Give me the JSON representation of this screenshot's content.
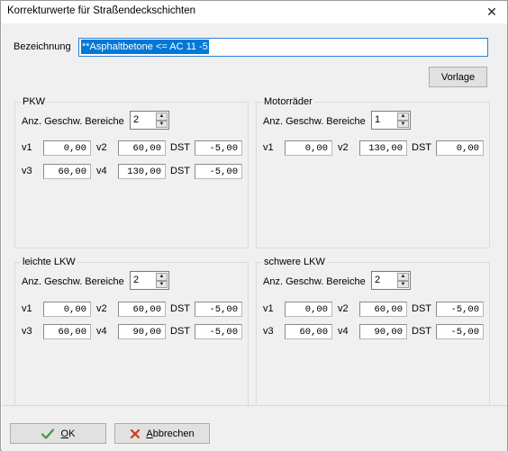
{
  "window": {
    "title": "Korrekturwerte für Straßendeckschichten",
    "close_glyph": "✕"
  },
  "name": {
    "label": "Bezeichnung",
    "value": "**Asphaltbetone <= AC 11 -5"
  },
  "template_button": "Vorlage",
  "common": {
    "ranges_label": "Anz. Geschw. Bereiche",
    "v1": "v1",
    "v2": "v2",
    "v3": "v3",
    "v4": "v4",
    "dst": "DST"
  },
  "groups": {
    "pkw": {
      "title": "PKW",
      "ranges": "2",
      "v1": "0,00",
      "v2": "60,00",
      "dst1": "-5,00",
      "v3": "60,00",
      "v4": "130,00",
      "dst2": "-5,00"
    },
    "motorraeder": {
      "title": "Motorräder",
      "ranges": "1",
      "v1": "0,00",
      "v2": "130,00",
      "dst1": "0,00"
    },
    "leichte_lkw": {
      "title": "leichte LKW",
      "ranges": "2",
      "v1": "0,00",
      "v2": "60,00",
      "dst1": "-5,00",
      "v3": "60,00",
      "v4": "90,00",
      "dst2": "-5,00"
    },
    "schwere_lkw": {
      "title": "schwere LKW",
      "ranges": "2",
      "v1": "0,00",
      "v2": "60,00",
      "dst1": "-5,00",
      "v3": "60,00",
      "v4": "90,00",
      "dst2": "-5,00"
    }
  },
  "buttons": {
    "ok_hotkey": "O",
    "ok_rest": "K",
    "cancel_hotkey": "A",
    "cancel_rest": "bbrechen"
  },
  "colors": {
    "ok_check": "#3a9a3a",
    "cancel_x": "#d03a1a",
    "selection": "#0078d7"
  },
  "icons": {
    "ok": "checkmark-icon",
    "cancel": "cross-icon"
  }
}
